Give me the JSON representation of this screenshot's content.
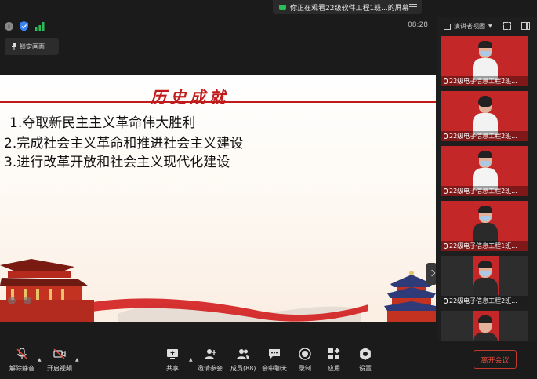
{
  "share_banner": {
    "text": "你正在观看22级软件工程1班...的屏幕"
  },
  "status": {
    "timer": "08:28"
  },
  "lock_view": {
    "label": "锁定画面"
  },
  "slide": {
    "title": "历史成就",
    "lines": [
      "1.夺取新民主主义革命伟大胜利",
      "2.完成社会主义革命和推进社会主义建设",
      "3.进行改革开放和社会主义现代化建设"
    ]
  },
  "panel": {
    "view_label": "演讲者视图",
    "tiles": [
      {
        "name": "22级电子信息工程2班..."
      },
      {
        "name": "22级电子信息工程2班..."
      },
      {
        "name": "22级电子信息工程2班..."
      },
      {
        "name": "22级电子信息工程1班..."
      },
      {
        "name": "22级电子信息工程2班..."
      }
    ]
  },
  "toolbar": {
    "unmute": "解除静音",
    "start_video": "开启视频",
    "share": "共享",
    "invite": "邀请参会",
    "members": "成员(88)",
    "chat": "会中聊天",
    "record": "录制",
    "apps": "应用",
    "settings": "设置",
    "leave": "离开会议"
  },
  "colors": {
    "accent_red": "#c11a1a",
    "tile_red": "#c32727",
    "leave_red": "#e74c3c",
    "share_green": "#2bbd5a"
  }
}
